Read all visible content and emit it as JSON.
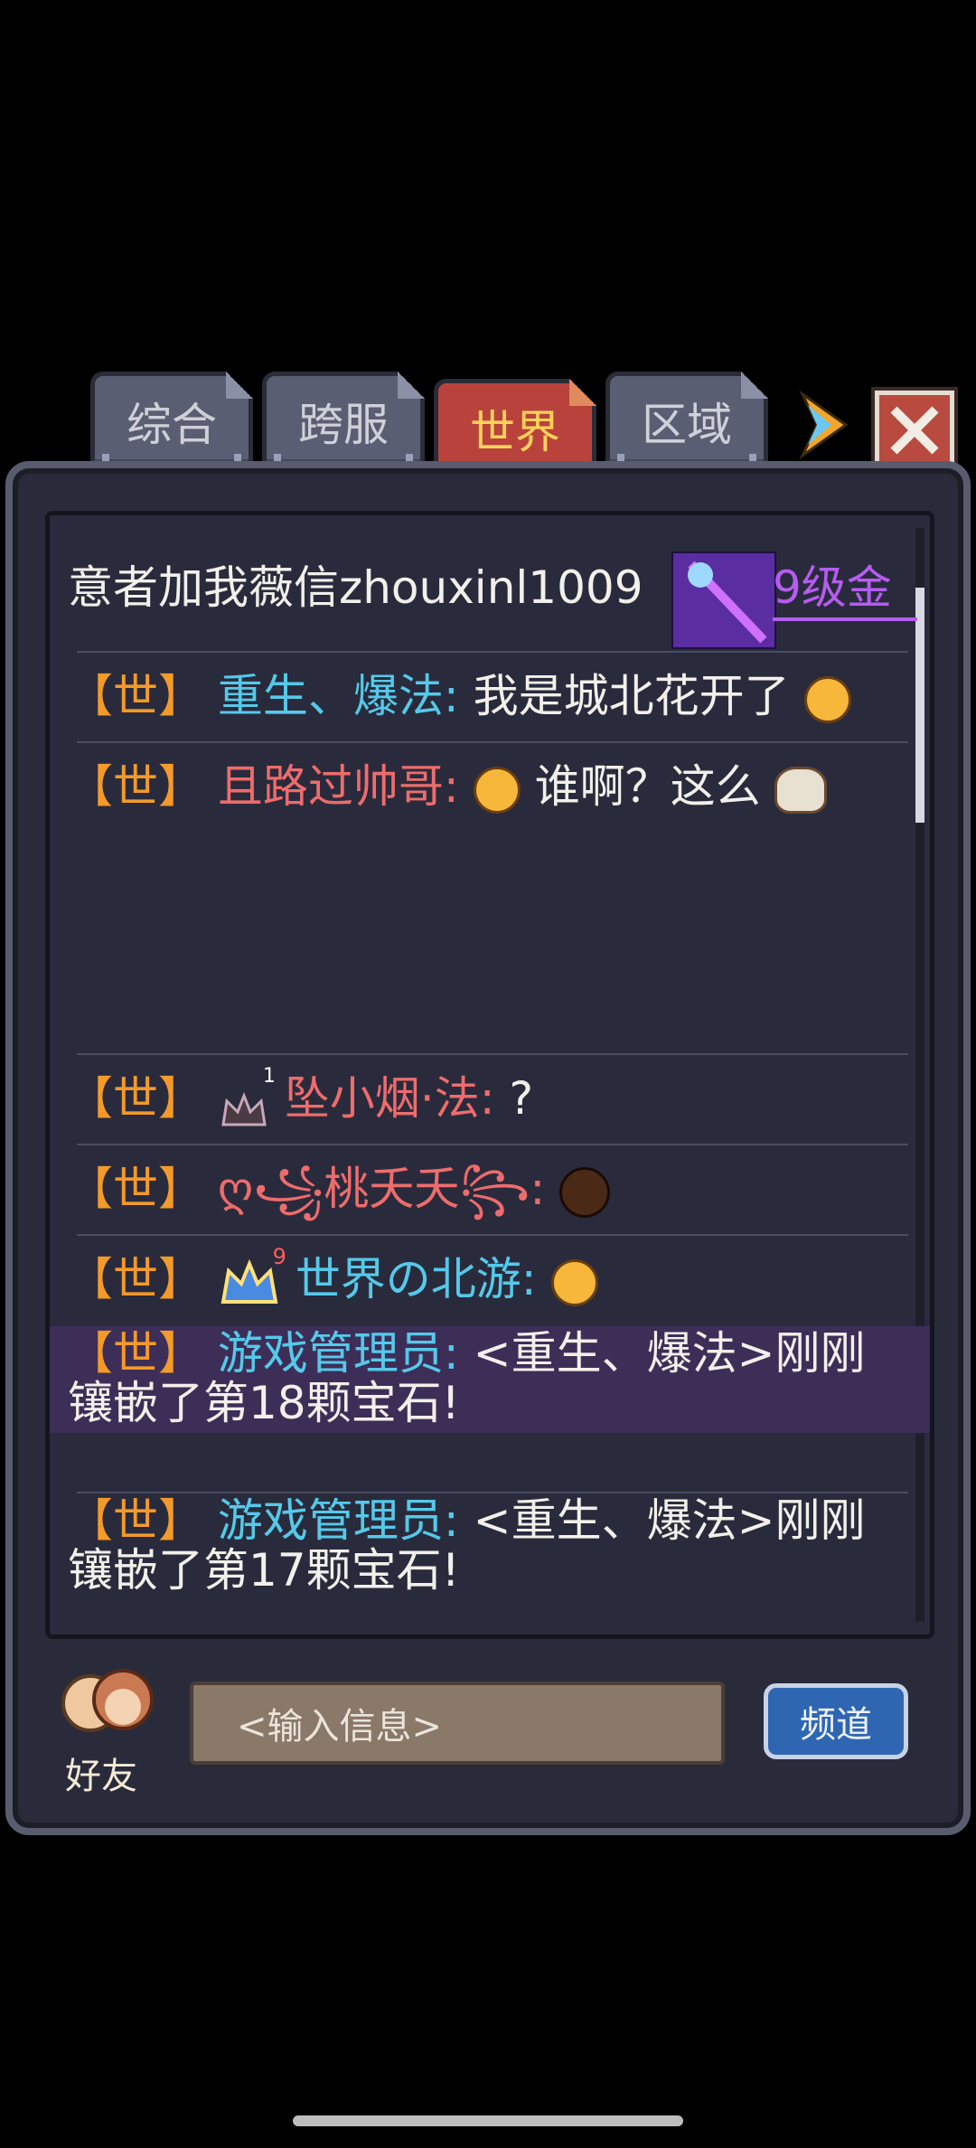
{
  "tabs": [
    "综合",
    "跨服",
    "世界",
    "区域"
  ],
  "active_tab": "世界",
  "messages": {
    "top_line": "意者加我薇信zhouxinl1009",
    "item_label": "9级金",
    "m1": {
      "tag": "【世】",
      "name": "重生、爆法:",
      "text": "我是城北花开了"
    },
    "m2": {
      "tag": "【世】",
      "name": "且路过帅哥:",
      "text": "谁啊？这么"
    },
    "m3": {
      "tag": "【世】",
      "name": "坠小烟·法:",
      "text": "?",
      "badge": "1"
    },
    "m4": {
      "tag": "【世】",
      "name": "ღ꧁桃夭夭꧂:",
      "text": ""
    },
    "m5": {
      "tag": "【世】",
      "name": "世界の北游:",
      "text": "",
      "badge": "9"
    },
    "m6": {
      "tag": "【世】",
      "name": "游戏管理员:",
      "text": "<重生、爆法>刚刚",
      "text2": "镶嵌了第18颗宝石!"
    },
    "m7": {
      "tag": "【世】",
      "name": "游戏管理员:",
      "text": "<重生、爆法>刚刚",
      "text2": "镶嵌了第17颗宝石!"
    }
  },
  "bottom": {
    "friends_label": "好友",
    "input_placeholder": "<输入信息>",
    "channel_label": "频道"
  },
  "colors": {
    "tag": "#f39a2a",
    "admin_name": "#55c9ea",
    "player_name": "#ee6c6c",
    "highlight": "#3d2e58",
    "active_tab": "#b9433c"
  }
}
